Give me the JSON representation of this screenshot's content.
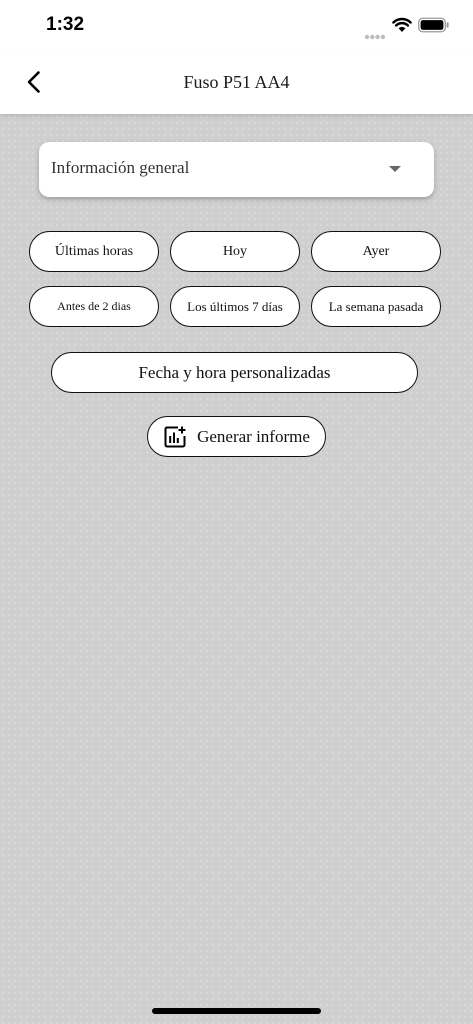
{
  "status_bar": {
    "time": "1:32"
  },
  "nav": {
    "title": "Fuso P51 AA4"
  },
  "dropdown": {
    "selected": "Información general"
  },
  "quick_ranges": [
    "Últimas horas",
    "Hoy",
    "Ayer",
    "Antes de 2 dias",
    "Los últimos 7 días",
    "La semana pasada"
  ],
  "custom_range_label": "Fecha y hora personalizadas",
  "generate_report_label": "Generar informe",
  "icons": {
    "back": "chevron-left-icon",
    "signal": "cellular-signal-icon",
    "wifi": "wifi-icon",
    "battery": "battery-icon",
    "dropdown": "triangle-down-icon",
    "report": "chart-plus-icon"
  },
  "colors": {
    "background": "#cfcfcf",
    "surface": "#ffffff",
    "border": "#111111"
  }
}
